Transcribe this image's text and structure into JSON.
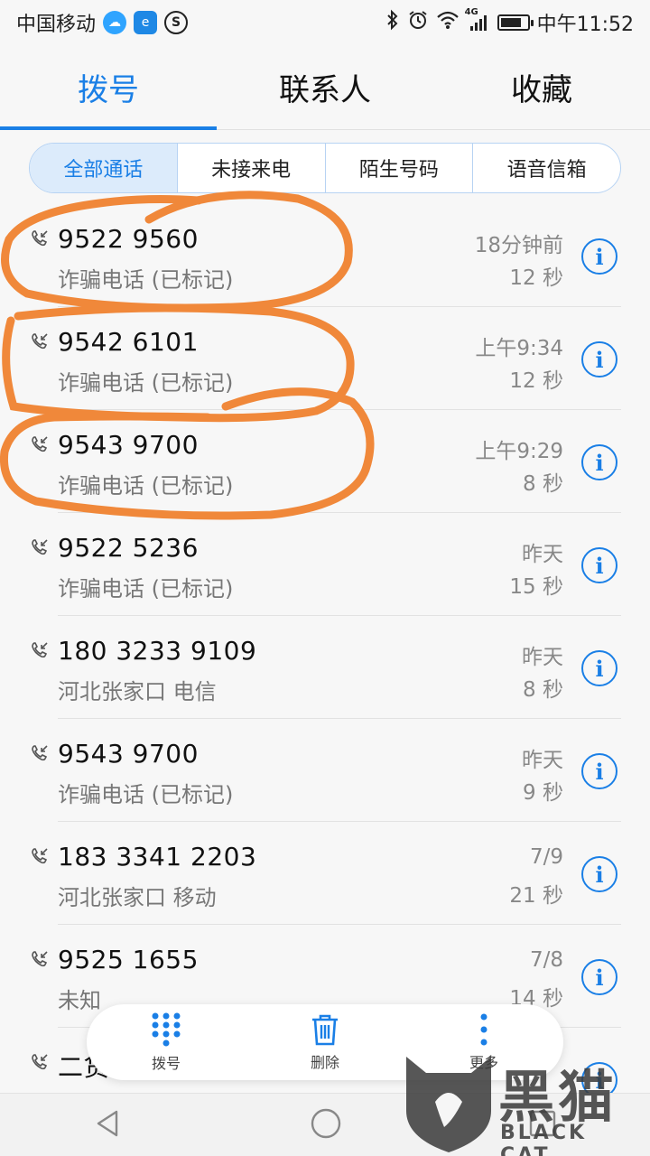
{
  "status_bar": {
    "carrier": "中国移动",
    "network": "4G",
    "time": "中午11:52"
  },
  "tabs": [
    {
      "label": "拨号",
      "active": true
    },
    {
      "label": "联系人",
      "active": false
    },
    {
      "label": "收藏",
      "active": false
    }
  ],
  "filters": [
    {
      "label": "全部通话",
      "active": true
    },
    {
      "label": "未接来电",
      "active": false
    },
    {
      "label": "陌生号码",
      "active": false
    },
    {
      "label": "语音信箱",
      "active": false
    }
  ],
  "calls": [
    {
      "number": "9522 9560",
      "label": "诈骗电话 (已标记)",
      "time": "18分钟前",
      "duration": "12 秒"
    },
    {
      "number": "9542 6101",
      "label": "诈骗电话 (已标记)",
      "time": "上午9:34",
      "duration": "12 秒"
    },
    {
      "number": "9543 9700",
      "label": "诈骗电话 (已标记)",
      "time": "上午9:29",
      "duration": "8 秒"
    },
    {
      "number": "9522 5236",
      "label": "诈骗电话 (已标记)",
      "time": "昨天",
      "duration": "15 秒"
    },
    {
      "number": "180 3233 9109",
      "label": "河北张家口 电信",
      "time": "昨天",
      "duration": "8 秒"
    },
    {
      "number": "9543 9700",
      "label": "诈骗电话 (已标记)",
      "time": "昨天",
      "duration": "9 秒"
    },
    {
      "number": "183 3341 2203",
      "label": "河北张家口 移动",
      "time": "7/9",
      "duration": "21 秒"
    },
    {
      "number": "9525 1655",
      "label": "未知",
      "time": "7/8",
      "duration": "14 秒"
    },
    {
      "number": "二货",
      "label": "",
      "time": "",
      "duration": ""
    }
  ],
  "info_glyph": "i",
  "action_bar": {
    "dial_label": "拨号",
    "delete_label": "删除",
    "more_label": "更多"
  },
  "watermark": {
    "text": "黑猫",
    "sub": "BLACK CAT"
  },
  "colors": {
    "accent": "#1a7fe6",
    "annotation": "#f0883a"
  }
}
